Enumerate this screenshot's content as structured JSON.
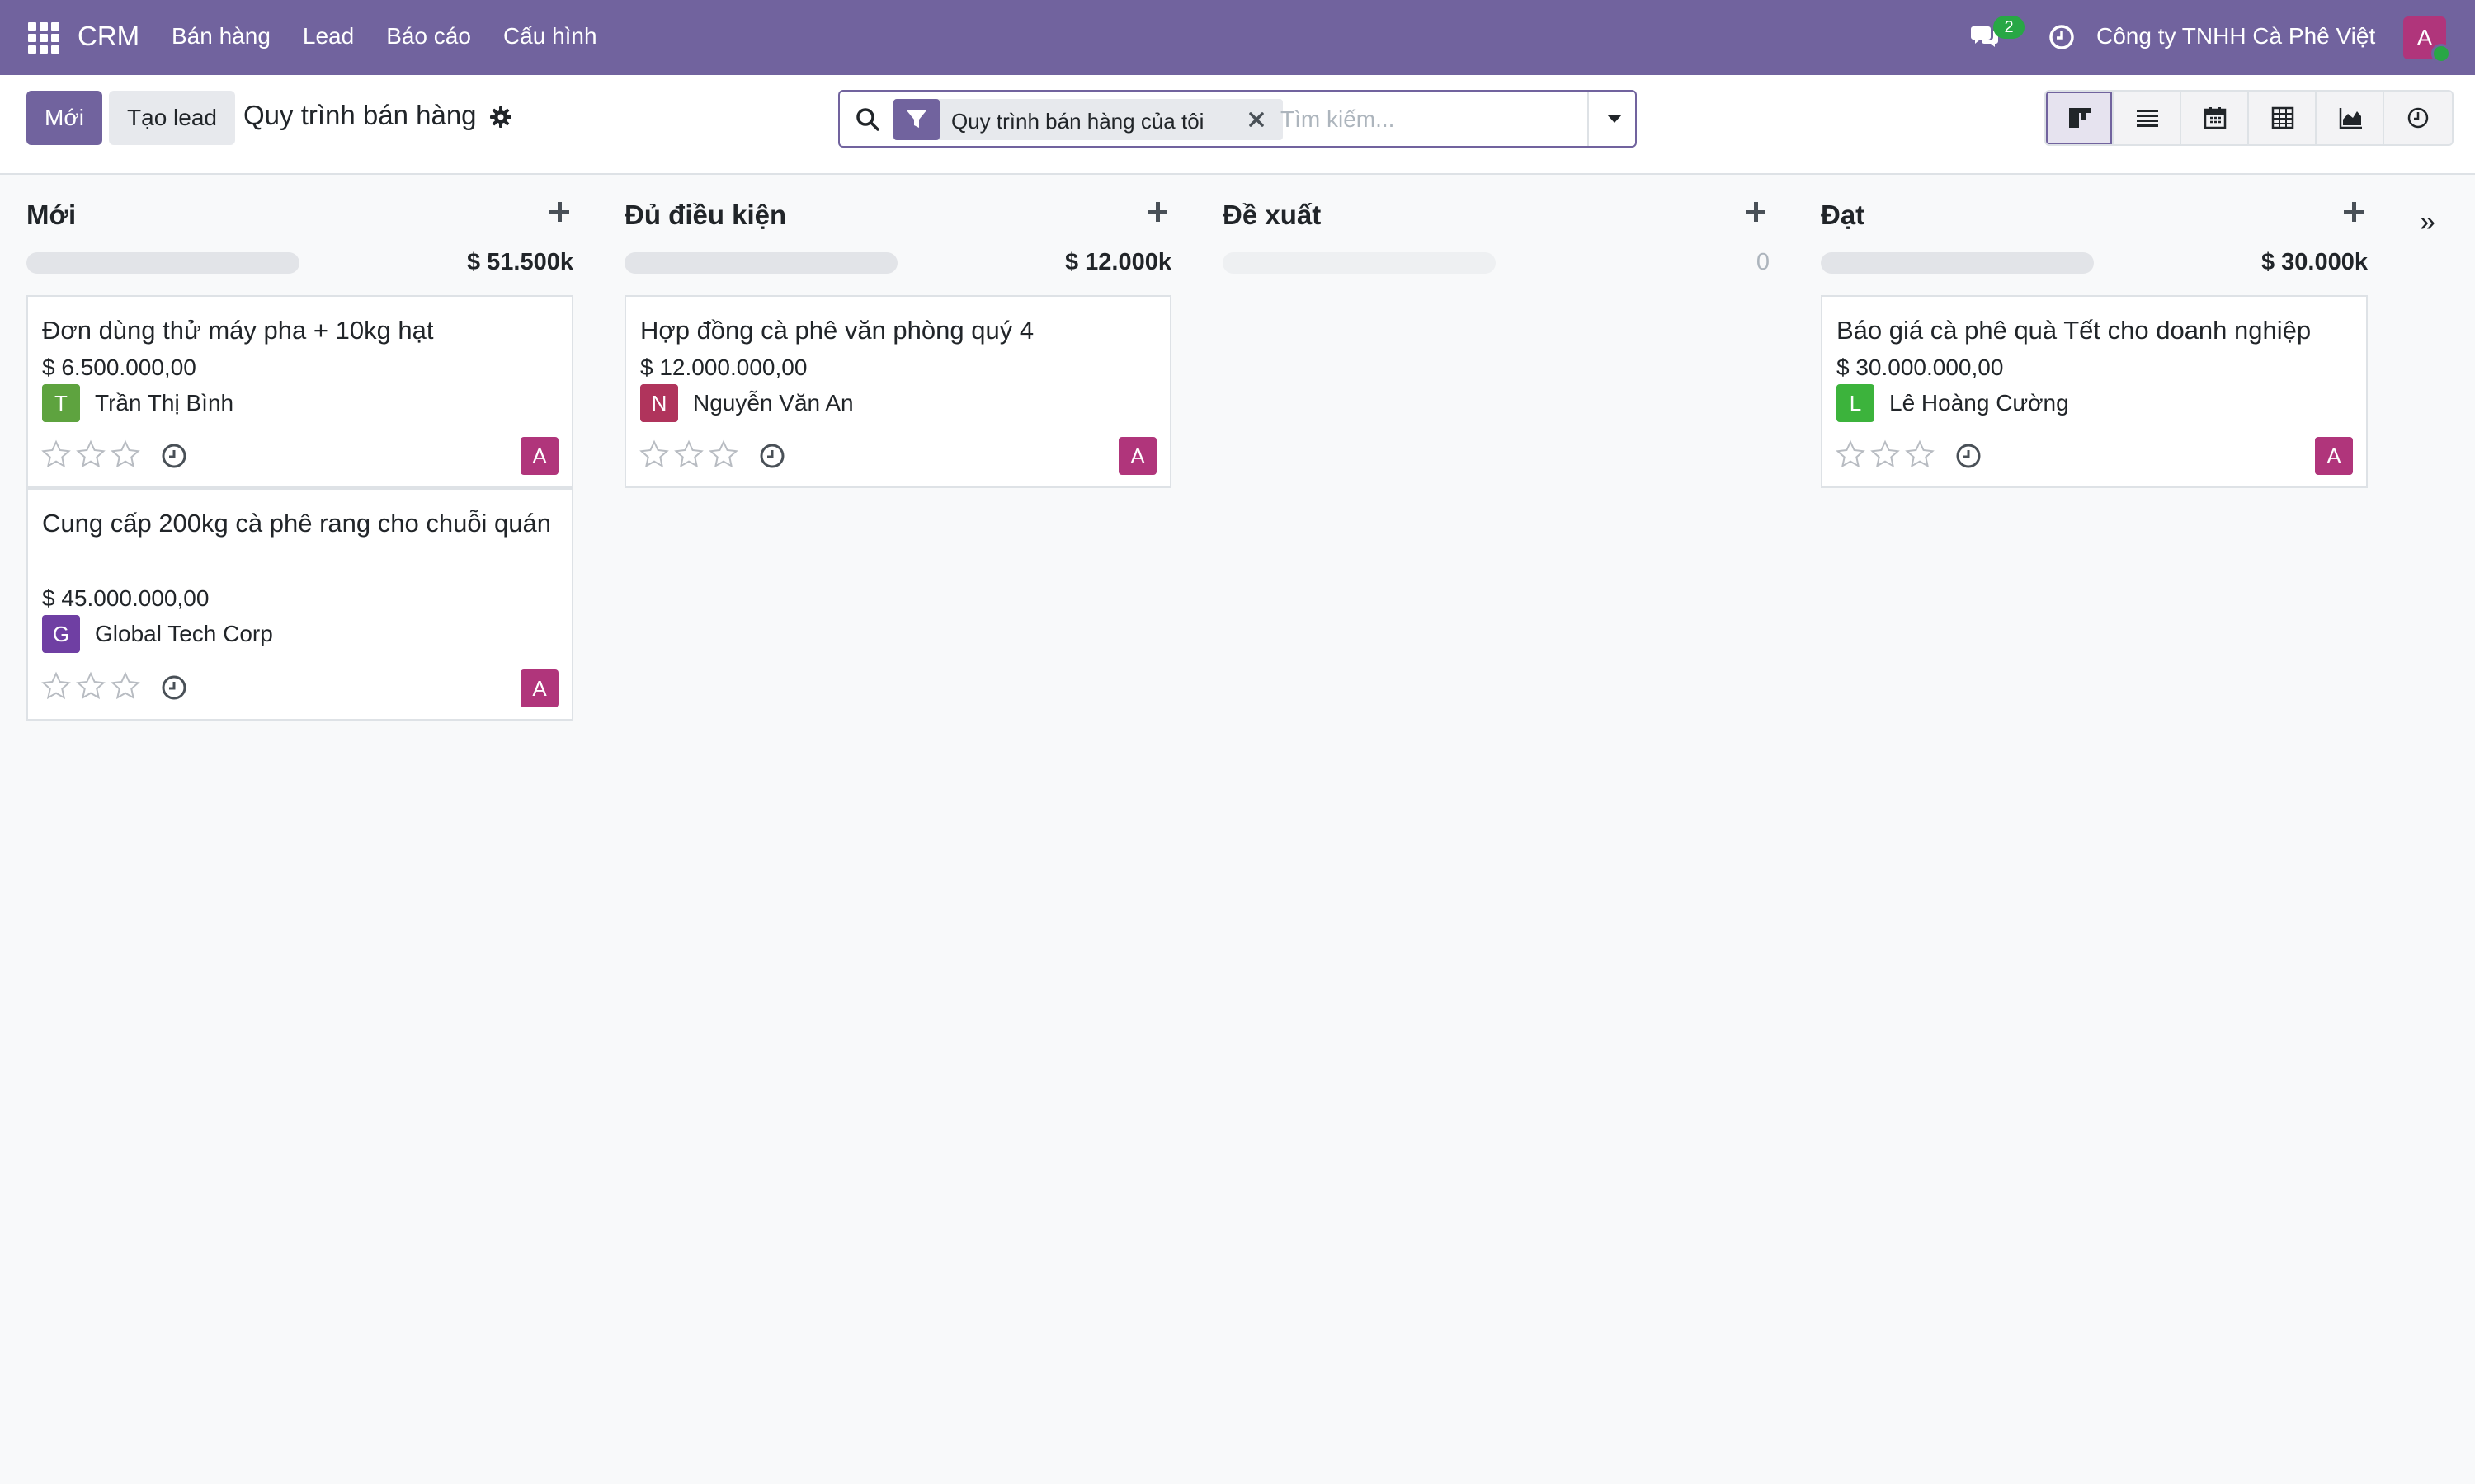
{
  "navbar": {
    "brand": "CRM",
    "menu": [
      "Bán hàng",
      "Lead",
      "Báo cáo",
      "Cấu hình"
    ],
    "chat_badge": "2",
    "company": "Công ty TNHH Cà Phê Việt",
    "user_initial": "A"
  },
  "control": {
    "new_button": "Mới",
    "lead_button": "Tạo lead",
    "title": "Quy trình bán hàng",
    "facet_label": "Quy trình bán hàng của tôi",
    "search_placeholder": "Tìm kiếm...",
    "views": [
      "kanban",
      "list",
      "calendar",
      "pivot",
      "graph",
      "activity"
    ],
    "active_view": "kanban"
  },
  "colors": {
    "brand": "#71639e",
    "avatar_user": "#b0357b",
    "partner_t": "#5ea33f",
    "partner_n": "#b0345c",
    "partner_g": "#6f3fa3",
    "partner_l": "#3cb33c"
  },
  "columns": [
    {
      "title": "Mới",
      "total": "$ 51.500k",
      "cards": [
        {
          "title": "Đơn dùng thử máy pha + 10kg hạt",
          "amount": "$ 6.500.000,00",
          "partner_initial": "T",
          "partner": "Trần Thị Bình",
          "user": "A",
          "stars": 0
        },
        {
          "title": "Cung cấp 200kg cà phê rang cho chuỗi quán",
          "amount": "$ 45.000.000,00",
          "partner_initial": "G",
          "partner": "Global Tech Corp",
          "user": "A",
          "stars": 0
        }
      ]
    },
    {
      "title": "Đủ điều kiện",
      "total": "$ 12.000k",
      "cards": [
        {
          "title": "Hợp đồng cà phê văn phòng quý 4",
          "amount": "$ 12.000.000,00",
          "partner_initial": "N",
          "partner": "Nguyễn Văn An",
          "user": "A",
          "stars": 0
        }
      ]
    },
    {
      "title": "Đề xuất",
      "total": "0",
      "cards": []
    },
    {
      "title": "Đạt",
      "total": "$ 30.000k",
      "cards": [
        {
          "title": "Báo giá cà phê quà Tết cho doanh nghiệp",
          "amount": "$ 30.000.000,00",
          "partner_initial": "L",
          "partner": "Lê Hoàng Cường",
          "user": "A",
          "stars": 0
        }
      ]
    }
  ],
  "fold_toggle": "»"
}
